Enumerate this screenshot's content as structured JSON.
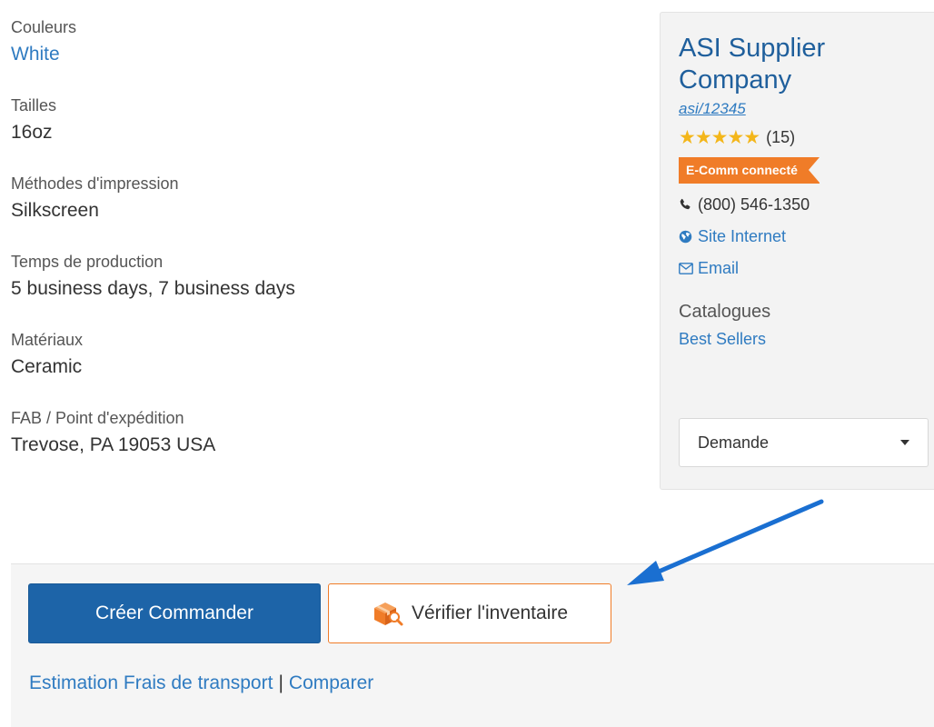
{
  "attributes": [
    {
      "label": "Couleurs",
      "value": "White",
      "is_link": true
    },
    {
      "label": "Tailles",
      "value": "16oz",
      "is_link": false
    },
    {
      "label": "Méthodes d'impression",
      "value": "Silkscreen",
      "is_link": false
    },
    {
      "label": "Temps de production",
      "value": "5 business days, 7 business days",
      "is_link": false
    },
    {
      "label": "Matériaux",
      "value": "Ceramic",
      "is_link": false
    },
    {
      "label": "FAB / Point d'expédition",
      "value": "Trevose, PA 19053 USA",
      "is_link": false
    }
  ],
  "supplier": {
    "name": "ASI Supplier Company",
    "asi": "asi/12345",
    "rating_stars": 5,
    "rating_count": "(15)",
    "badge": "E-Comm connecté",
    "phone": "(800) 546-1350",
    "website_label": "Site Internet",
    "email_label": "Email",
    "catalogs_label": "Catalogues",
    "catalog_value": "Best Sellers",
    "dropdown_value": "Demande",
    "icons": {
      "phone": "phone-icon",
      "website": "globe-icon",
      "email": "envelope-icon",
      "dropdown": "caret-down-icon"
    }
  },
  "actions": {
    "primary_button": "Créer Commander",
    "inventory_button": "Vérifier l'inventaire",
    "inventory_icon": "box-search-icon",
    "link_shipping": "Estimation Frais de transport",
    "separator": "|",
    "link_compare": "Comparer"
  },
  "colors": {
    "link": "#2f7bc1",
    "supplier_name": "#1f5f9c",
    "primary": "#1d64a8",
    "accent_orange": "#f07c28",
    "star": "#f3b61a",
    "annotation_arrow": "#1a6fd1"
  }
}
